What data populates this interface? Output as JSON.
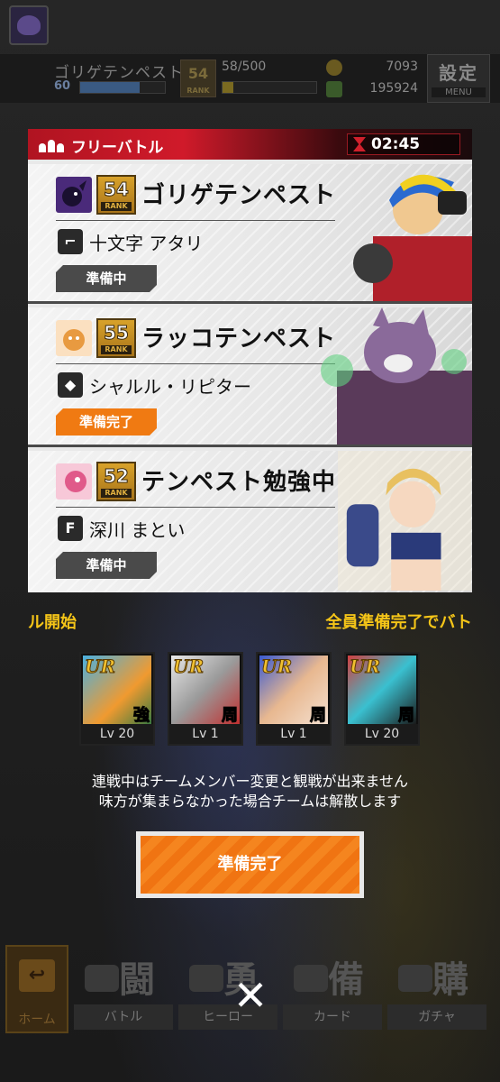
{
  "top_bar": {
    "player_name": "ゴリゲテンペスト",
    "player_level": "60",
    "player_rank": "54",
    "rank_label": "RANK",
    "exp": "58/500",
    "exp_fraction": 0.116,
    "level_fraction": 0.7,
    "coins": "7093",
    "gems": "195924",
    "menu_kanji": "設定",
    "menu_label": "MENU"
  },
  "dialog": {
    "title": "フリーバトル",
    "timer": "02:45",
    "players": [
      {
        "rank": "54",
        "rank_label": "RANK",
        "name": "ゴリゲテンペスト",
        "character": "十文字 アタリ",
        "status": "準備中",
        "ready": false
      },
      {
        "rank": "55",
        "rank_label": "RANK",
        "name": "ラッコテンペスト",
        "character": "シャルル・リピター",
        "status": "準備完了",
        "ready": true
      },
      {
        "rank": "52",
        "rank_label": "RANK",
        "name": "テンペスト勉強中",
        "character": "深川 まとい",
        "status": "準備中",
        "ready": false
      }
    ]
  },
  "marquee": {
    "left": "ル開始",
    "right": "全員準備完了でバト"
  },
  "cards": [
    {
      "rarity": "UR",
      "role": "強",
      "level": "Lv 20"
    },
    {
      "rarity": "UR",
      "role": "周",
      "level": "Lv 1"
    },
    {
      "rarity": "UR",
      "role": "周",
      "level": "Lv 1"
    },
    {
      "rarity": "UR",
      "role": "周",
      "level": "Lv 20"
    }
  ],
  "notice": {
    "line1": "連戦中はチームメンバー変更と観戦が出来ません",
    "line2": "味方が集まらなかった場合チームは解散します"
  },
  "ready_button": "準備完了",
  "bottom_nav": {
    "home": "ホーム",
    "battle_kanji": "闘",
    "battle": "バトル",
    "hero_kanji": "勇",
    "hero": "ヒーロー",
    "card_kanji": "備",
    "card": "カード",
    "gacha_kanji": "購",
    "gacha": "ガチャ"
  },
  "colors": {
    "accent_orange": "#f07a12",
    "header_red": "#d01a2a",
    "marquee_yellow": "#f5c518"
  }
}
